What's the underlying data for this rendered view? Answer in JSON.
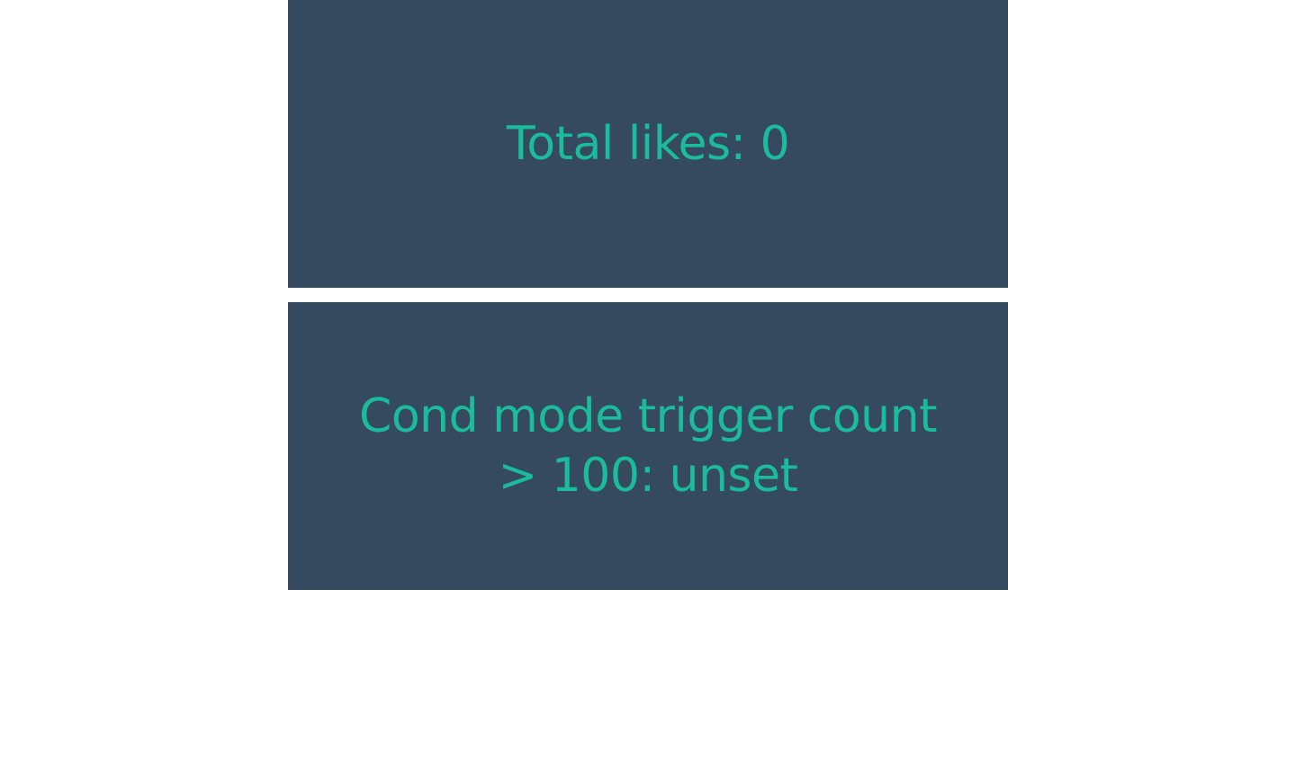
{
  "colors": {
    "panel_background": "#354a5f",
    "text": "#1abc9c",
    "page_background": "#ffffff"
  },
  "panels": [
    {
      "text": "Total likes: 0"
    },
    {
      "text": "Cond mode trigger count > 100: unset"
    }
  ]
}
